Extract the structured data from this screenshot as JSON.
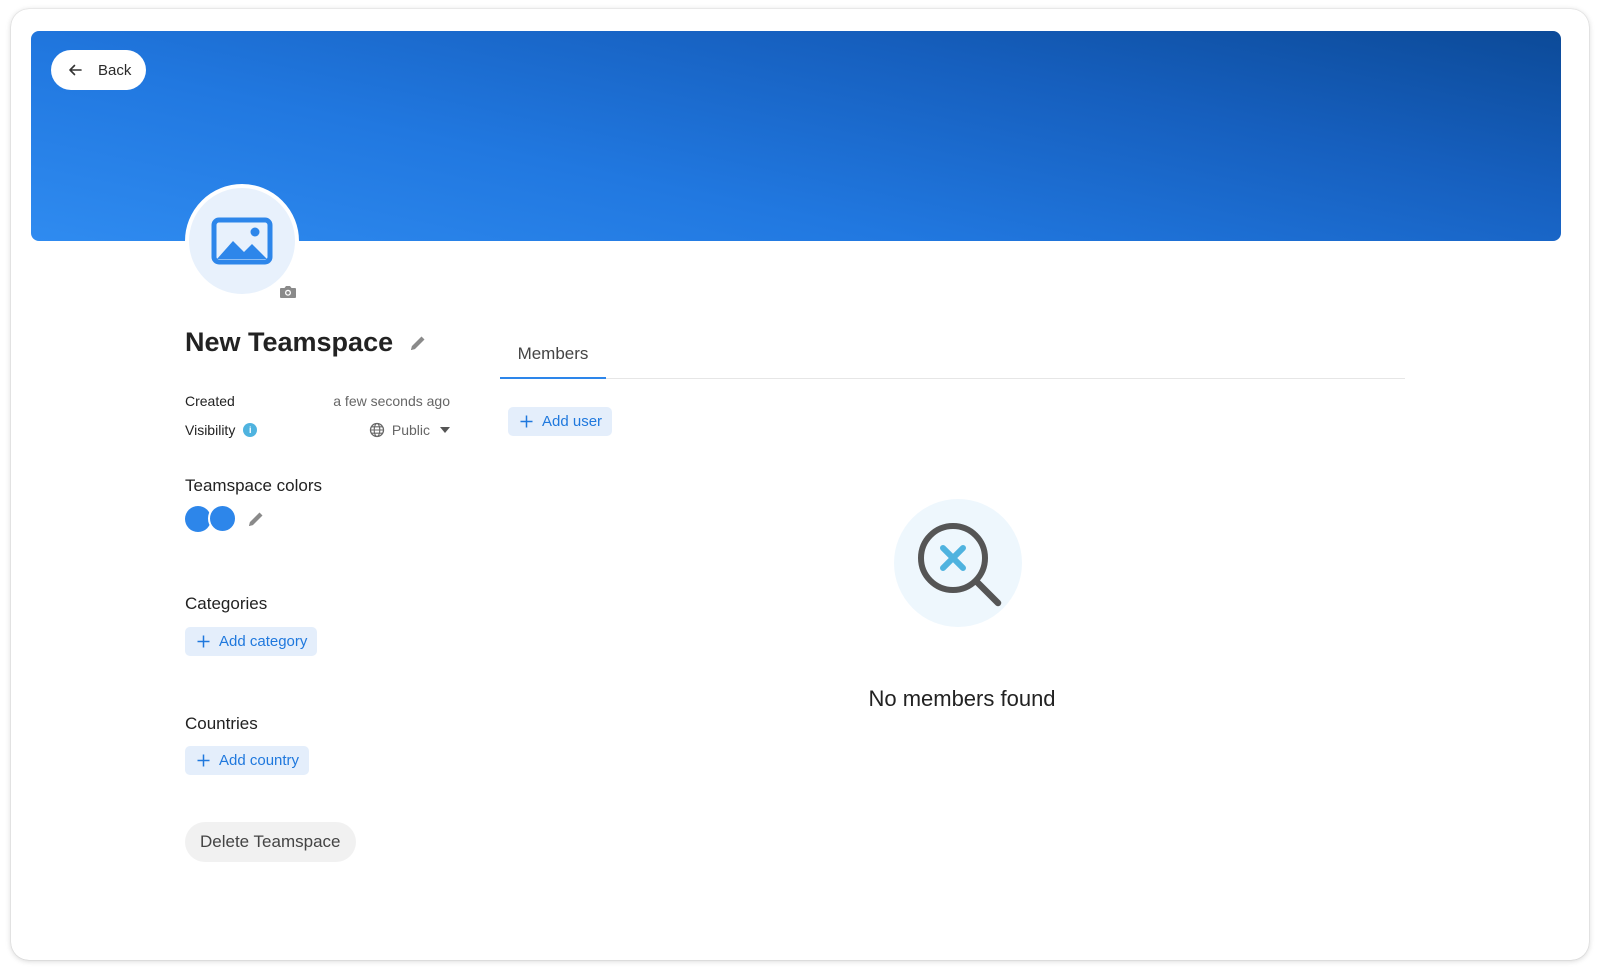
{
  "header": {
    "back_label": "Back"
  },
  "teamspace": {
    "name": "New Teamspace",
    "created_label": "Created",
    "created_value": "a few seconds ago",
    "visibility_label": "Visibility",
    "visibility_info": "i",
    "visibility_value": "Public",
    "colors_label": "Teamspace colors",
    "colors": [
      "#2d86ea",
      "#2d86ea"
    ],
    "categories_label": "Categories",
    "add_category_label": "Add category",
    "countries_label": "Countries",
    "add_country_label": "Add country",
    "delete_label": "Delete Teamspace"
  },
  "main": {
    "tabs": [
      {
        "label": "Members",
        "active": true
      }
    ],
    "add_user_label": "Add user",
    "empty_message": "No members found"
  },
  "theme": {
    "accent": "#2d86ea",
    "banner_start": "#2f8bf0",
    "banner_end": "#0c4a98"
  },
  "icons": {
    "back": "arrow-left-icon",
    "avatar": "image-placeholder-icon",
    "camera": "camera-icon",
    "edit": "pencil-icon",
    "info": "info-icon",
    "visibility": "globe-icon",
    "dropdown": "caret-down-icon",
    "add": "plus-icon",
    "empty": "search-x-icon"
  }
}
